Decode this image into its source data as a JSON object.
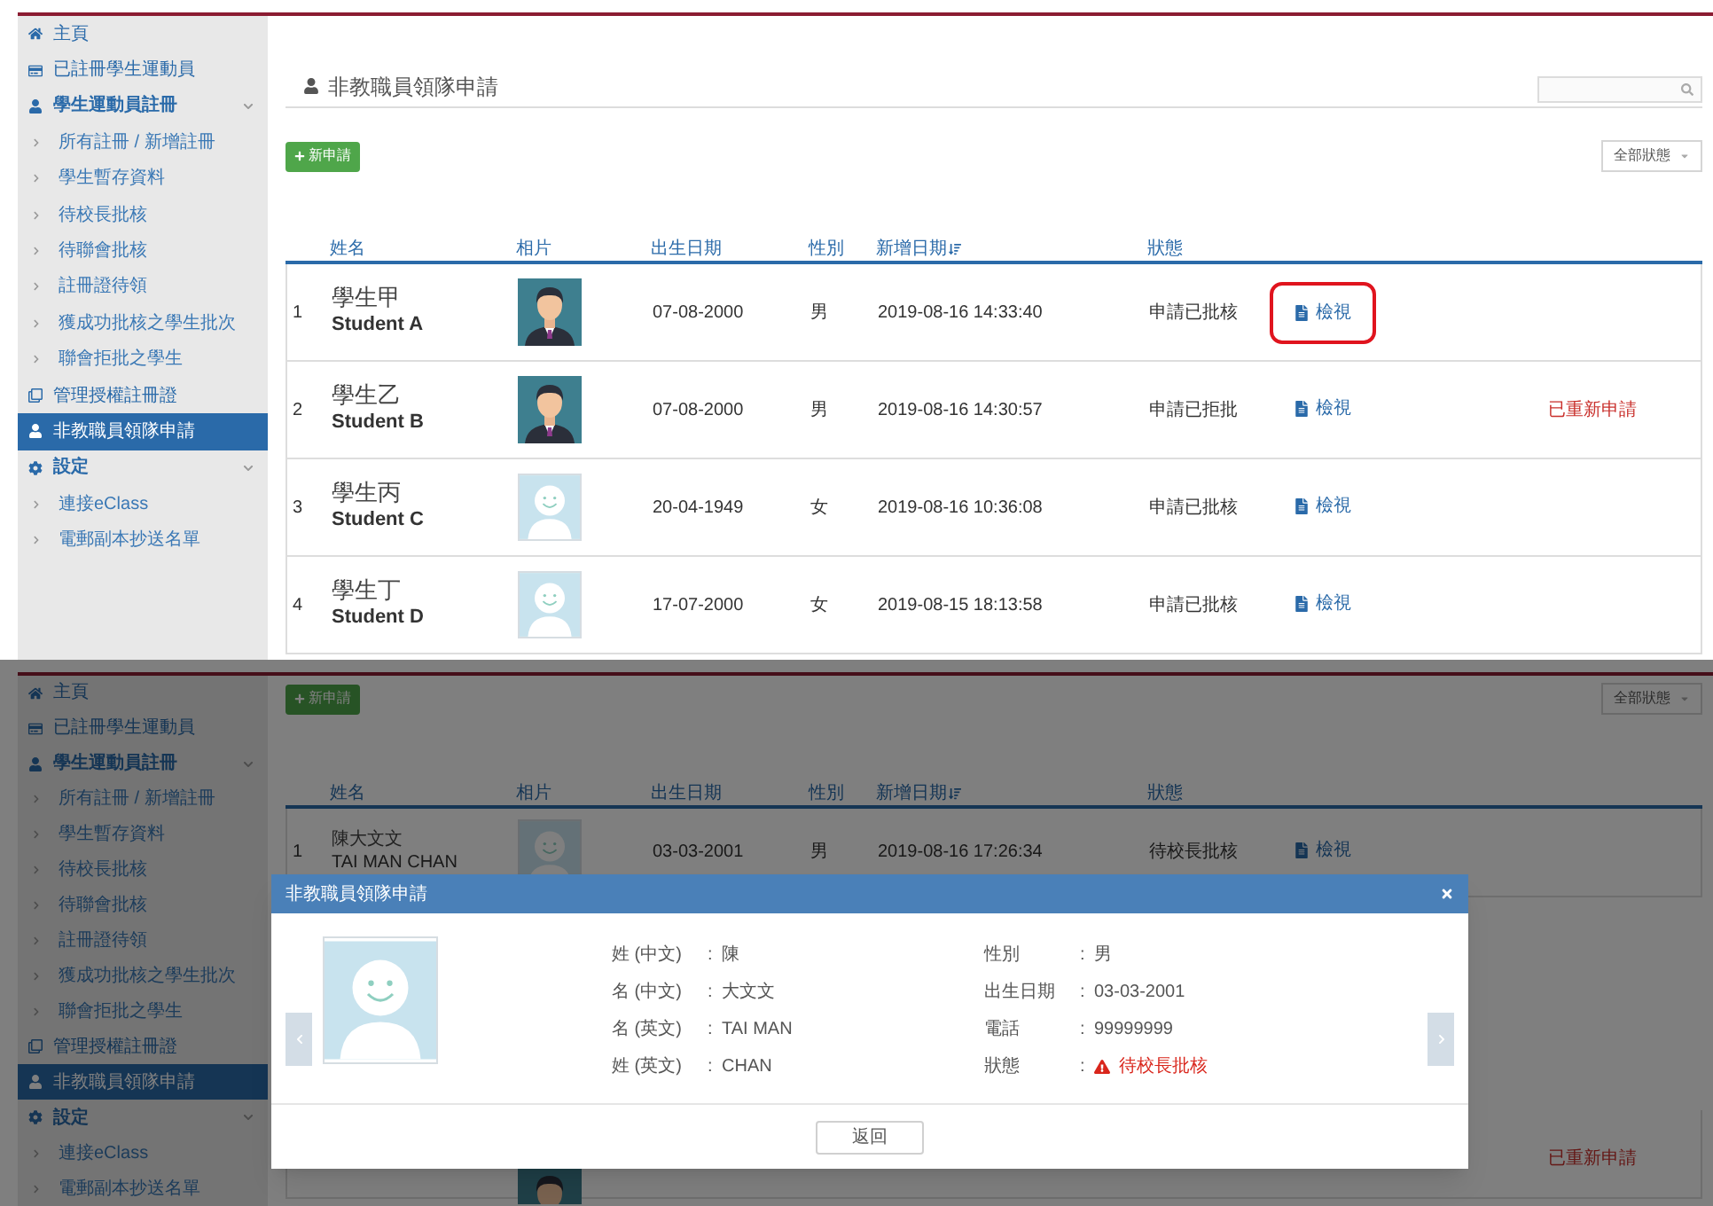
{
  "views": [
    {
      "sidebar": {
        "items": [
          {
            "label": "主頁",
            "kind": "page",
            "selected": false
          },
          {
            "label": "已註冊學生運動員",
            "kind": "page",
            "selected": false
          },
          {
            "label": "學生運動員註冊",
            "kind": "group",
            "selected": false,
            "expanded": true,
            "children": [
              {
                "label": "所有註冊 / 新增註冊",
                "selected": false
              },
              {
                "label": "學生暫存資料",
                "selected": false
              },
              {
                "label": "待校長批核",
                "selected": false
              },
              {
                "label": "待聯會批核",
                "selected": false
              },
              {
                "label": "註冊證待領",
                "selected": false
              },
              {
                "label": "獲成功批核之學生批次",
                "selected": false
              },
              {
                "label": "聯會拒批之學生",
                "selected": false
              }
            ]
          },
          {
            "label": "管理授權註冊證",
            "kind": "page",
            "selected": false
          },
          {
            "label": "非教職員領隊申請",
            "kind": "page",
            "selected": true
          },
          {
            "label": "設定",
            "kind": "group",
            "selected": false,
            "expanded": true,
            "children": [
              {
                "label": "連接eClass",
                "selected": false
              },
              {
                "label": "電郵副本抄送名單",
                "selected": false
              }
            ]
          }
        ]
      },
      "page_title": "非教職員領隊申請",
      "search_visible": true,
      "new_button": "新申請",
      "status_filter": "全部狀態",
      "table": {
        "columns": [
          "姓名",
          "相片",
          "出生日期",
          "性別",
          "新增日期",
          "狀態"
        ],
        "rows": [
          {
            "index": "1",
            "name_zh": "學生甲",
            "name_en": "Student A",
            "kind": "male",
            "dob": "07-08-2000",
            "gender": "男",
            "created": "2019-08-16 14:33:40",
            "status": "申請已批核",
            "action": "檢視",
            "highlighted": true
          },
          {
            "index": "2",
            "name_zh": "學生乙",
            "name_en": "Student B",
            "kind": "male",
            "dob": "07-08-2000",
            "gender": "男",
            "created": "2019-08-16 14:30:57",
            "status": "申請已拒批",
            "action": "檢視",
            "highlighted": false,
            "note": "已重新申請"
          },
          {
            "index": "3",
            "name_zh": "學生丙",
            "name_en": "Student C",
            "kind": "default",
            "dob": "20-04-1949",
            "gender": "女",
            "created": "2019-08-16 10:36:08",
            "status": "申請已批核",
            "action": "檢視",
            "highlighted": false
          },
          {
            "index": "4",
            "name_zh": "學生丁",
            "name_en": "Student D",
            "kind": "default",
            "dob": "17-07-2000",
            "gender": "女",
            "created": "2019-08-15 18:13:58",
            "status": "申請已批核",
            "action": "檢視",
            "highlighted": false
          }
        ]
      }
    },
    {
      "sidebar": {
        "items": [
          {
            "label": "主頁",
            "kind": "page",
            "selected": false
          },
          {
            "label": "已註冊學生運動員",
            "kind": "page",
            "selected": false
          },
          {
            "label": "學生運動員註冊",
            "kind": "group",
            "selected": false,
            "expanded": true,
            "children": [
              {
                "label": "所有註冊 / 新增註冊",
                "selected": false
              },
              {
                "label": "學生暫存資料",
                "selected": false
              },
              {
                "label": "待校長批核",
                "selected": false
              },
              {
                "label": "待聯會批核",
                "selected": false
              },
              {
                "label": "註冊證待領",
                "selected": false
              },
              {
                "label": "獲成功批核之學生批次",
                "selected": false
              },
              {
                "label": "聯會拒批之學生",
                "selected": false
              }
            ]
          },
          {
            "label": "管理授權註冊證",
            "kind": "page",
            "selected": false
          },
          {
            "label": "非教職員領隊申請",
            "kind": "page",
            "selected": true
          },
          {
            "label": "設定",
            "kind": "group",
            "selected": false,
            "expanded": true,
            "children": [
              {
                "label": "連接eClass",
                "selected": false
              },
              {
                "label": "電郵副本抄送名單",
                "selected": false
              }
            ]
          }
        ]
      },
      "new_button": "新申請",
      "status_filter": "全部狀態",
      "table": {
        "columns": [
          "姓名",
          "相片",
          "出生日期",
          "性別",
          "新增日期",
          "狀態"
        ],
        "rows": [
          {
            "index": "1",
            "name_zh": "陳大文文",
            "name_en": "TAI MAN CHAN",
            "kind": "default",
            "dob": "03-03-2001",
            "gender": "男",
            "created": "2019-08-16 17:26:34",
            "status": "待校長批核",
            "action": "檢視",
            "highlighted": false
          },
          {
            "kind": "male",
            "note": "已重新申請"
          }
        ]
      },
      "modal": {
        "title": "非教職員領隊申請",
        "kind": "default",
        "left_fields": [
          {
            "label": "姓 (中文)",
            "sep": ":",
            "value": "陳",
            "kind": "plain"
          },
          {
            "label": "名 (中文)",
            "sep": ":",
            "value": "大文文",
            "kind": "plain"
          },
          {
            "label": "名 (英文)",
            "sep": ":",
            "value": "TAI MAN",
            "kind": "plain"
          },
          {
            "label": "姓 (英文)",
            "sep": ":",
            "value": "CHAN",
            "kind": "plain"
          }
        ],
        "right_fields": [
          {
            "label": "性別",
            "sep": ":",
            "value": "男",
            "kind": "plain"
          },
          {
            "label": "出生日期",
            "sep": ":",
            "value": "03-03-2001",
            "kind": "plain"
          },
          {
            "label": "電話",
            "sep": ":",
            "value": "99999999",
            "kind": "plain"
          },
          {
            "label": "狀態",
            "sep": ":",
            "value": "待校長批核",
            "kind": "warning"
          }
        ],
        "button": "返回"
      }
    }
  ]
}
